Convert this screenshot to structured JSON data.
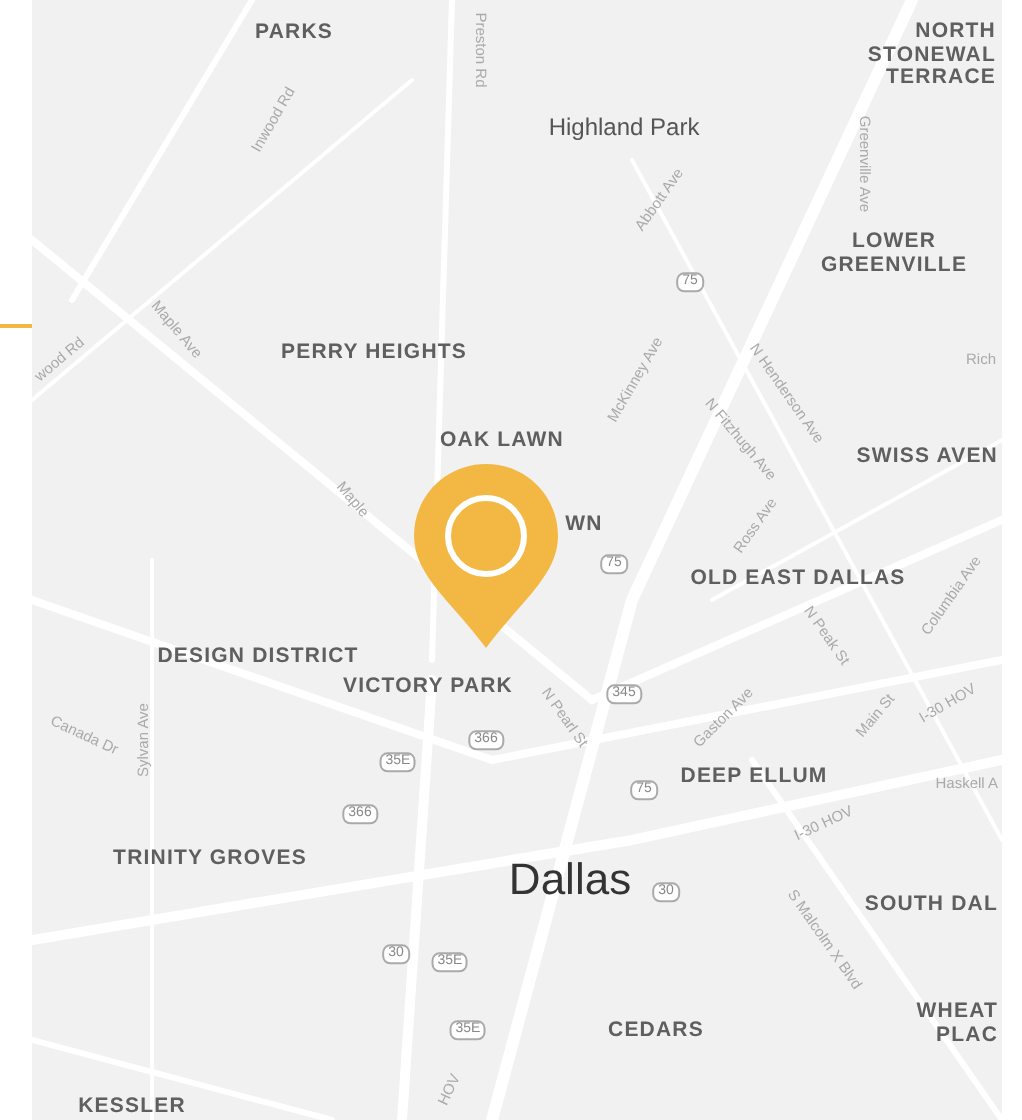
{
  "map": {
    "labels": [
      {
        "text": "PARKS",
        "kind": "district"
      },
      {
        "text": "Preston Rd",
        "kind": "street"
      },
      {
        "text": "Inwood Rd",
        "kind": "street"
      },
      {
        "text": "Highland Park",
        "kind": "place"
      },
      {
        "text": "NORTH\nSTONEWAL\nTERRACE",
        "kind": "district"
      },
      {
        "text": "Greenville Ave",
        "kind": "street"
      },
      {
        "text": "Abbott Ave",
        "kind": "street"
      },
      {
        "text": "75",
        "kind": "shield"
      },
      {
        "text": "LOWER\nGREENVILLE",
        "kind": "district"
      },
      {
        "text": "PERRY HEIGHTS",
        "kind": "district"
      },
      {
        "text": "Maple Ave",
        "kind": "street"
      },
      {
        "text": "wood Rd",
        "kind": "street"
      },
      {
        "text": "McKinney Ave",
        "kind": "street"
      },
      {
        "text": "N Henderson Ave",
        "kind": "street"
      },
      {
        "text": "N Fitzhugh Ave",
        "kind": "street"
      },
      {
        "text": "Rich",
        "kind": "street"
      },
      {
        "text": "OAK LAWN",
        "kind": "district"
      },
      {
        "text": "SWISS AVEN",
        "kind": "district"
      },
      {
        "text": "WN",
        "kind": "district"
      },
      {
        "text": "Maple",
        "kind": "street"
      },
      {
        "text": "Ross Ave",
        "kind": "street"
      },
      {
        "text": "75",
        "kind": "shield"
      },
      {
        "text": "OLD EAST DALLAS",
        "kind": "district"
      },
      {
        "text": "N Peak St",
        "kind": "street"
      },
      {
        "text": "Columbia Ave",
        "kind": "street"
      },
      {
        "text": "DESIGN DISTRICT",
        "kind": "district"
      },
      {
        "text": "VICTORY PARK",
        "kind": "district"
      },
      {
        "text": "N Pearl St",
        "kind": "street"
      },
      {
        "text": "345",
        "kind": "shield"
      },
      {
        "text": "Gaston Ave",
        "kind": "street"
      },
      {
        "text": "Main St",
        "kind": "street"
      },
      {
        "text": "I-30 HOV",
        "kind": "street"
      },
      {
        "text": "Canada Dr",
        "kind": "street"
      },
      {
        "text": "Sylvan Ave",
        "kind": "street"
      },
      {
        "text": "366",
        "kind": "shield"
      },
      {
        "text": "35E",
        "kind": "shield"
      },
      {
        "text": "75",
        "kind": "shield"
      },
      {
        "text": "DEEP ELLUM",
        "kind": "district"
      },
      {
        "text": "Haskell A",
        "kind": "street"
      },
      {
        "text": "366",
        "kind": "shield"
      },
      {
        "text": "I-30 HOV",
        "kind": "street"
      },
      {
        "text": "TRINITY GROVES",
        "kind": "district"
      },
      {
        "text": "Dallas",
        "kind": "city"
      },
      {
        "text": "30",
        "kind": "shield"
      },
      {
        "text": "S Malcolm X Blvd",
        "kind": "street"
      },
      {
        "text": "SOUTH DAL",
        "kind": "district"
      },
      {
        "text": "30",
        "kind": "shield"
      },
      {
        "text": "35E",
        "kind": "shield"
      },
      {
        "text": "35E",
        "kind": "shield"
      },
      {
        "text": "CEDARS",
        "kind": "district"
      },
      {
        "text": "WHEAT\nPLAC",
        "kind": "district"
      },
      {
        "text": "KESSLER",
        "kind": "district"
      },
      {
        "text": "HOV",
        "kind": "street"
      }
    ]
  }
}
